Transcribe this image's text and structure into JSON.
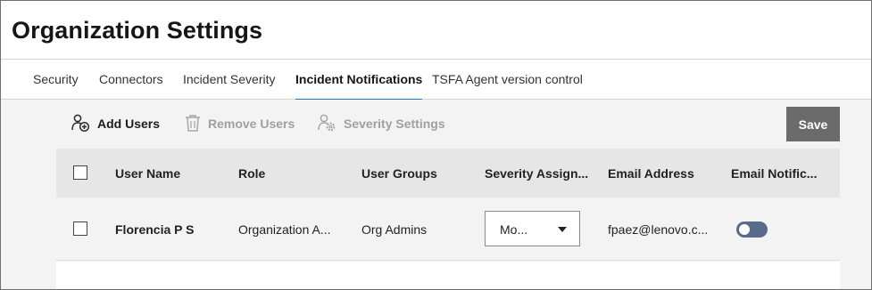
{
  "page": {
    "title": "Organization Settings"
  },
  "tabs": [
    {
      "label": "Security",
      "active": false
    },
    {
      "label": "Connectors",
      "active": false
    },
    {
      "label": "Incident Severity",
      "active": false
    },
    {
      "label": "Incident Notifications",
      "active": true
    },
    {
      "label": "TSFA Agent version control",
      "active": false
    }
  ],
  "toolbar": {
    "add_users": {
      "label": "Add Users",
      "icon": "add-user-icon",
      "enabled": true
    },
    "remove_users": {
      "label": "Remove Users",
      "icon": "trash-icon",
      "enabled": false
    },
    "severity_settings": {
      "label": "Severity Settings",
      "icon": "user-settings-icon",
      "enabled": false
    },
    "save_label": "Save"
  },
  "table": {
    "columns": [
      "User Name",
      "Role",
      "User Groups",
      "Severity Assign...",
      "Email Address",
      "Email Notific..."
    ],
    "rows": [
      {
        "selected": false,
        "user_name": "Florencia P S",
        "role": "Organization A...",
        "user_groups": "Org Admins",
        "severity": "Mo...",
        "email": "fpaez@lenovo.c...",
        "email_notifications": false
      }
    ]
  },
  "colors": {
    "accent": "#1f76c7",
    "save_button": "#6b6b6b",
    "toggle_off": "#5a6b8a",
    "header_bg": "#e6e6e6",
    "content_bg": "#f3f3f3"
  }
}
